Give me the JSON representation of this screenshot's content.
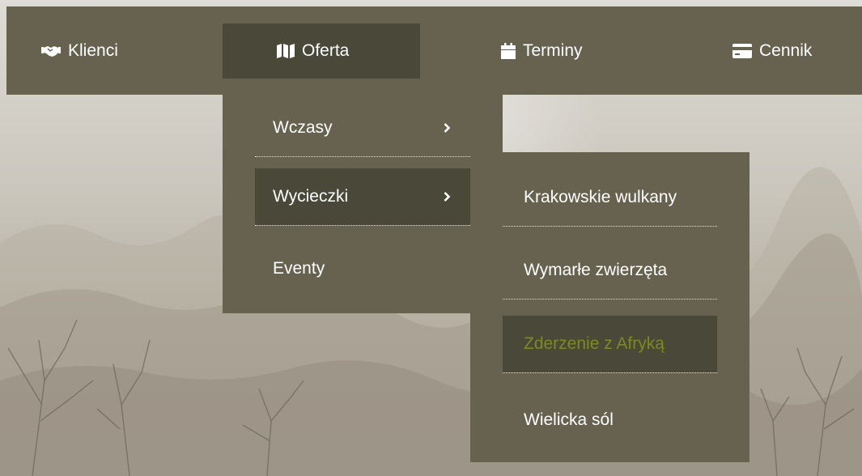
{
  "colors": {
    "bar_bg": "#66624f",
    "active_bg": "#4a4838",
    "text": "#ffffff",
    "hover_text": "#7d8a1f",
    "separator": "#e6e3d8"
  },
  "nav": {
    "items": [
      {
        "label": "Klienci",
        "icon": "handshake-icon"
      },
      {
        "label": "Oferta",
        "icon": "map-icon",
        "active": true
      },
      {
        "label": "Terminy",
        "icon": "calendar-icon"
      },
      {
        "label": "Cennik",
        "icon": "credit-card-icon"
      }
    ]
  },
  "oferta_menu": {
    "items": [
      {
        "label": "Wczasy",
        "icon": "chevron-right-icon"
      },
      {
        "label": "Wycieczki",
        "icon": "chevron-right-icon",
        "active": true
      },
      {
        "label": "Eventy"
      }
    ]
  },
  "wycieczki_submenu": {
    "items": [
      {
        "label": "Krakowskie wulkany"
      },
      {
        "label": "Wymarłe zwierzęta"
      },
      {
        "label": "Zderzenie z Afryką",
        "hover": true
      },
      {
        "label": "Wielicka sól"
      }
    ]
  }
}
